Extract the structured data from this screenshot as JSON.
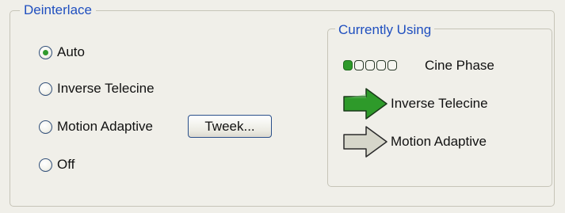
{
  "deinterlace": {
    "title": "Deinterlace",
    "options": [
      {
        "label": "Auto",
        "checked": true
      },
      {
        "label": "Inverse Telecine",
        "checked": false
      },
      {
        "label": "Motion Adaptive",
        "checked": false
      },
      {
        "label": "Off",
        "checked": false
      }
    ],
    "tweak_button": "Tweek..."
  },
  "currently_using": {
    "title": "Currently Using",
    "cine_phase": {
      "label": "Cine Phase",
      "dots_total": 5,
      "dots_active": 1
    },
    "modes": [
      {
        "label": "Inverse Telecine",
        "active": true
      },
      {
        "label": "Motion Adaptive",
        "active": false
      }
    ]
  },
  "colors": {
    "group_title": "#1f4fbf",
    "active_green": "#2e9a2a",
    "inactive_gray": "#d2d2c6",
    "background": "#f0efe9"
  }
}
